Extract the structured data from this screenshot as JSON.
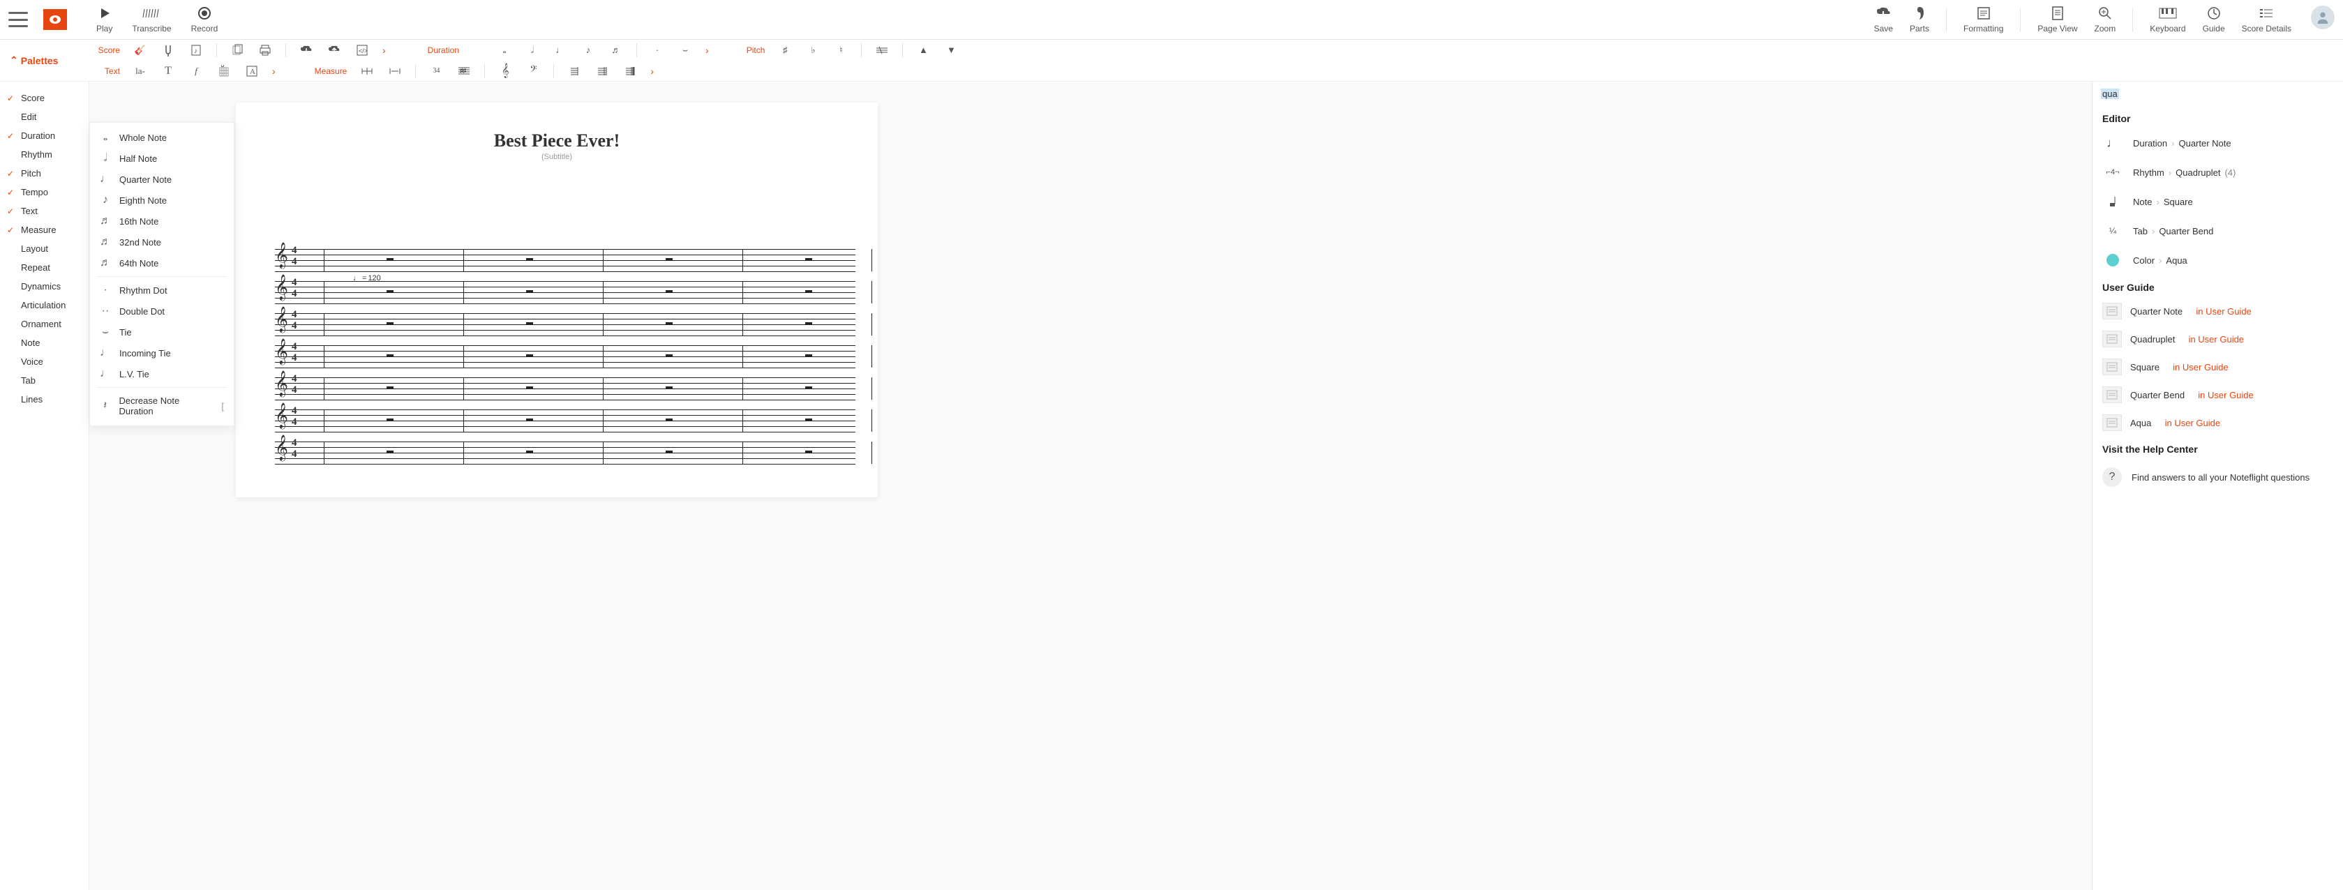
{
  "top": {
    "left": [
      {
        "id": "play",
        "label": "Play"
      },
      {
        "id": "transcribe",
        "label": "Transcribe"
      },
      {
        "id": "record",
        "label": "Record"
      }
    ],
    "right": [
      {
        "id": "save",
        "label": "Save"
      },
      {
        "id": "parts",
        "label": "Parts"
      },
      {
        "id": "formatting",
        "label": "Formatting"
      },
      {
        "id": "pageview",
        "label": "Page View"
      },
      {
        "id": "zoom",
        "label": "Zoom"
      },
      {
        "id": "keyboard",
        "label": "Keyboard"
      },
      {
        "id": "guide",
        "label": "Guide"
      },
      {
        "id": "scoredetails",
        "label": "Score Details"
      }
    ]
  },
  "palettes_label": "Palettes",
  "row_labels": {
    "score": "Score",
    "text": "Text",
    "duration": "Duration",
    "measure": "Measure",
    "pitch": "Pitch"
  },
  "palette_items": [
    {
      "label": "Score",
      "checked": true
    },
    {
      "label": "Edit",
      "checked": false
    },
    {
      "label": "Duration",
      "checked": true
    },
    {
      "label": "Rhythm",
      "checked": false
    },
    {
      "label": "Pitch",
      "checked": true
    },
    {
      "label": "Tempo",
      "checked": true
    },
    {
      "label": "Text",
      "checked": true
    },
    {
      "label": "Measure",
      "checked": true
    },
    {
      "label": "Layout",
      "checked": false
    },
    {
      "label": "Repeat",
      "checked": false
    },
    {
      "label": "Dynamics",
      "checked": false
    },
    {
      "label": "Articulation",
      "checked": false
    },
    {
      "label": "Ornament",
      "checked": false
    },
    {
      "label": "Note",
      "checked": false
    },
    {
      "label": "Voice",
      "checked": false
    },
    {
      "label": "Tab",
      "checked": false
    },
    {
      "label": "Lines",
      "checked": false
    }
  ],
  "duration_menu": [
    {
      "label": "Whole Note",
      "glyph": "𝅝"
    },
    {
      "label": "Half Note",
      "glyph": "𝅗𝅥"
    },
    {
      "label": "Quarter Note",
      "glyph": "♩"
    },
    {
      "label": "Eighth Note",
      "glyph": "♪"
    },
    {
      "label": "16th Note",
      "glyph": "♬"
    },
    {
      "label": "32nd Note",
      "glyph": "♬"
    },
    {
      "label": "64th Note",
      "glyph": "♬"
    },
    {
      "sep": true
    },
    {
      "label": "Rhythm Dot",
      "glyph": "·"
    },
    {
      "label": "Double Dot",
      "glyph": "··"
    },
    {
      "label": "Tie",
      "glyph": "⌣"
    },
    {
      "label": "Incoming Tie",
      "glyph": "♩"
    },
    {
      "label": "L.V. Tie",
      "glyph": "♩"
    },
    {
      "sep": true
    },
    {
      "label": "Decrease Note Duration",
      "glyph": "𝄽",
      "shortcut": "["
    }
  ],
  "score": {
    "title": "Best Piece Ever!",
    "subtitle": "(Subtitle)",
    "tempo_note": "♩",
    "tempo_eq": "=",
    "tempo_value": "120",
    "time_top": "4",
    "time_bottom": "4",
    "staves": 7
  },
  "search": {
    "query": "qua",
    "sections": {
      "editor": "Editor",
      "userguide": "User Guide",
      "help": "Visit the Help Center"
    },
    "editor_results": [
      {
        "icon": "quarter",
        "path": [
          "Duration",
          "Quarter Note"
        ]
      },
      {
        "icon": "quad",
        "path": [
          "Rhythm",
          "Quadruplet"
        ],
        "hint": "(4)"
      },
      {
        "icon": "square",
        "path": [
          "Note",
          "Square"
        ]
      },
      {
        "icon": "frac",
        "path": [
          "Tab",
          "Quarter Bend"
        ]
      },
      {
        "icon": "aqua",
        "path": [
          "Color",
          "Aqua"
        ]
      }
    ],
    "guide_results": [
      {
        "title": "Quarter Note",
        "link": "in User Guide"
      },
      {
        "title": "Quadruplet",
        "link": "in User Guide"
      },
      {
        "title": "Square",
        "link": "in User Guide"
      },
      {
        "title": "Quarter Bend",
        "link": "in User Guide"
      },
      {
        "title": "Aqua",
        "link": "in User Guide"
      }
    ],
    "help_text": "Find answers to all your Noteflight questions"
  }
}
